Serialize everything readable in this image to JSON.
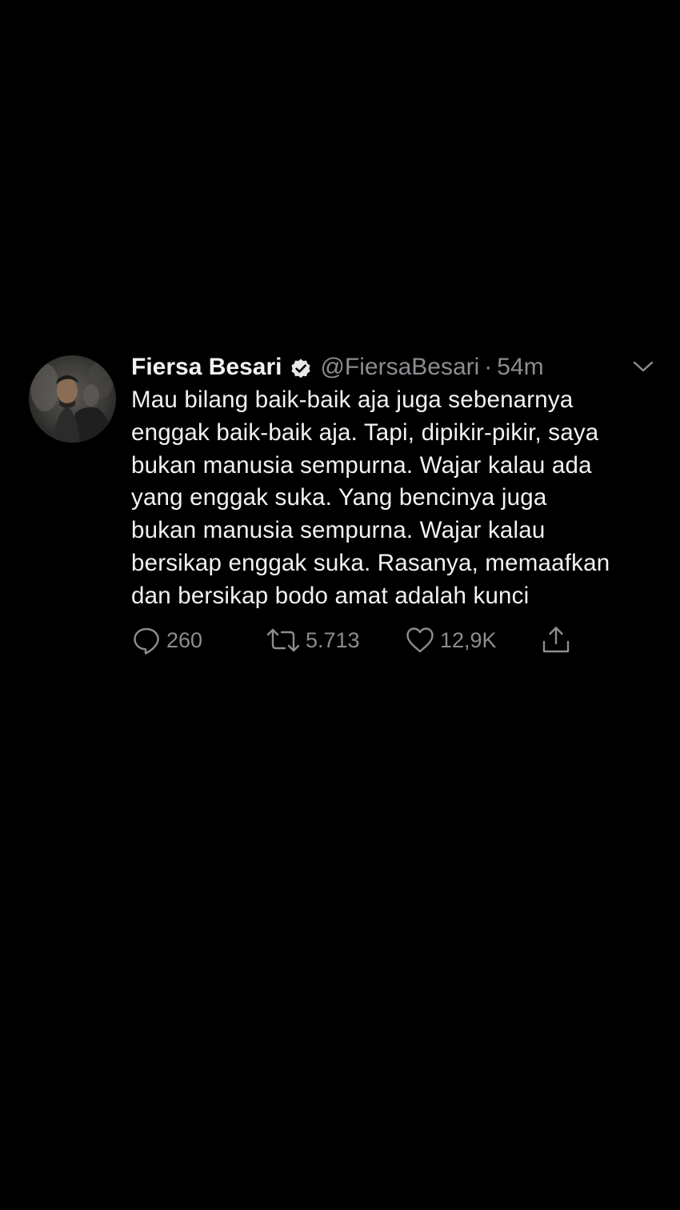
{
  "tweet": {
    "author_name": "Fiersa Besari",
    "handle": "@FiersaBesari",
    "separator": "·",
    "time": "54m",
    "verified_icon": "verified-badge-icon",
    "lines": [
      "Mau bilang baik-baik aja juga sebenarnya",
      "enggak baik-baik aja. Tapi, dipikir-pikir, saya",
      "bukan manusia sempurna. Wajar kalau ada",
      "yang enggak suka. Yang bencinya juga",
      "bukan manusia sempurna. Wajar kalau",
      "bersikap enggak suka. Rasanya, memaafkan",
      "dan bersikap bodo amat adalah kunci"
    ],
    "actions": {
      "reply_count": "260",
      "retweet_count": "5.713",
      "like_count": "12,9K",
      "icons": [
        "reply-icon",
        "retweet-icon",
        "like-icon",
        "share-icon"
      ]
    }
  },
  "colors": {
    "background": "#000000",
    "text": "#f2f2f2",
    "muted": "#8a8d91"
  }
}
